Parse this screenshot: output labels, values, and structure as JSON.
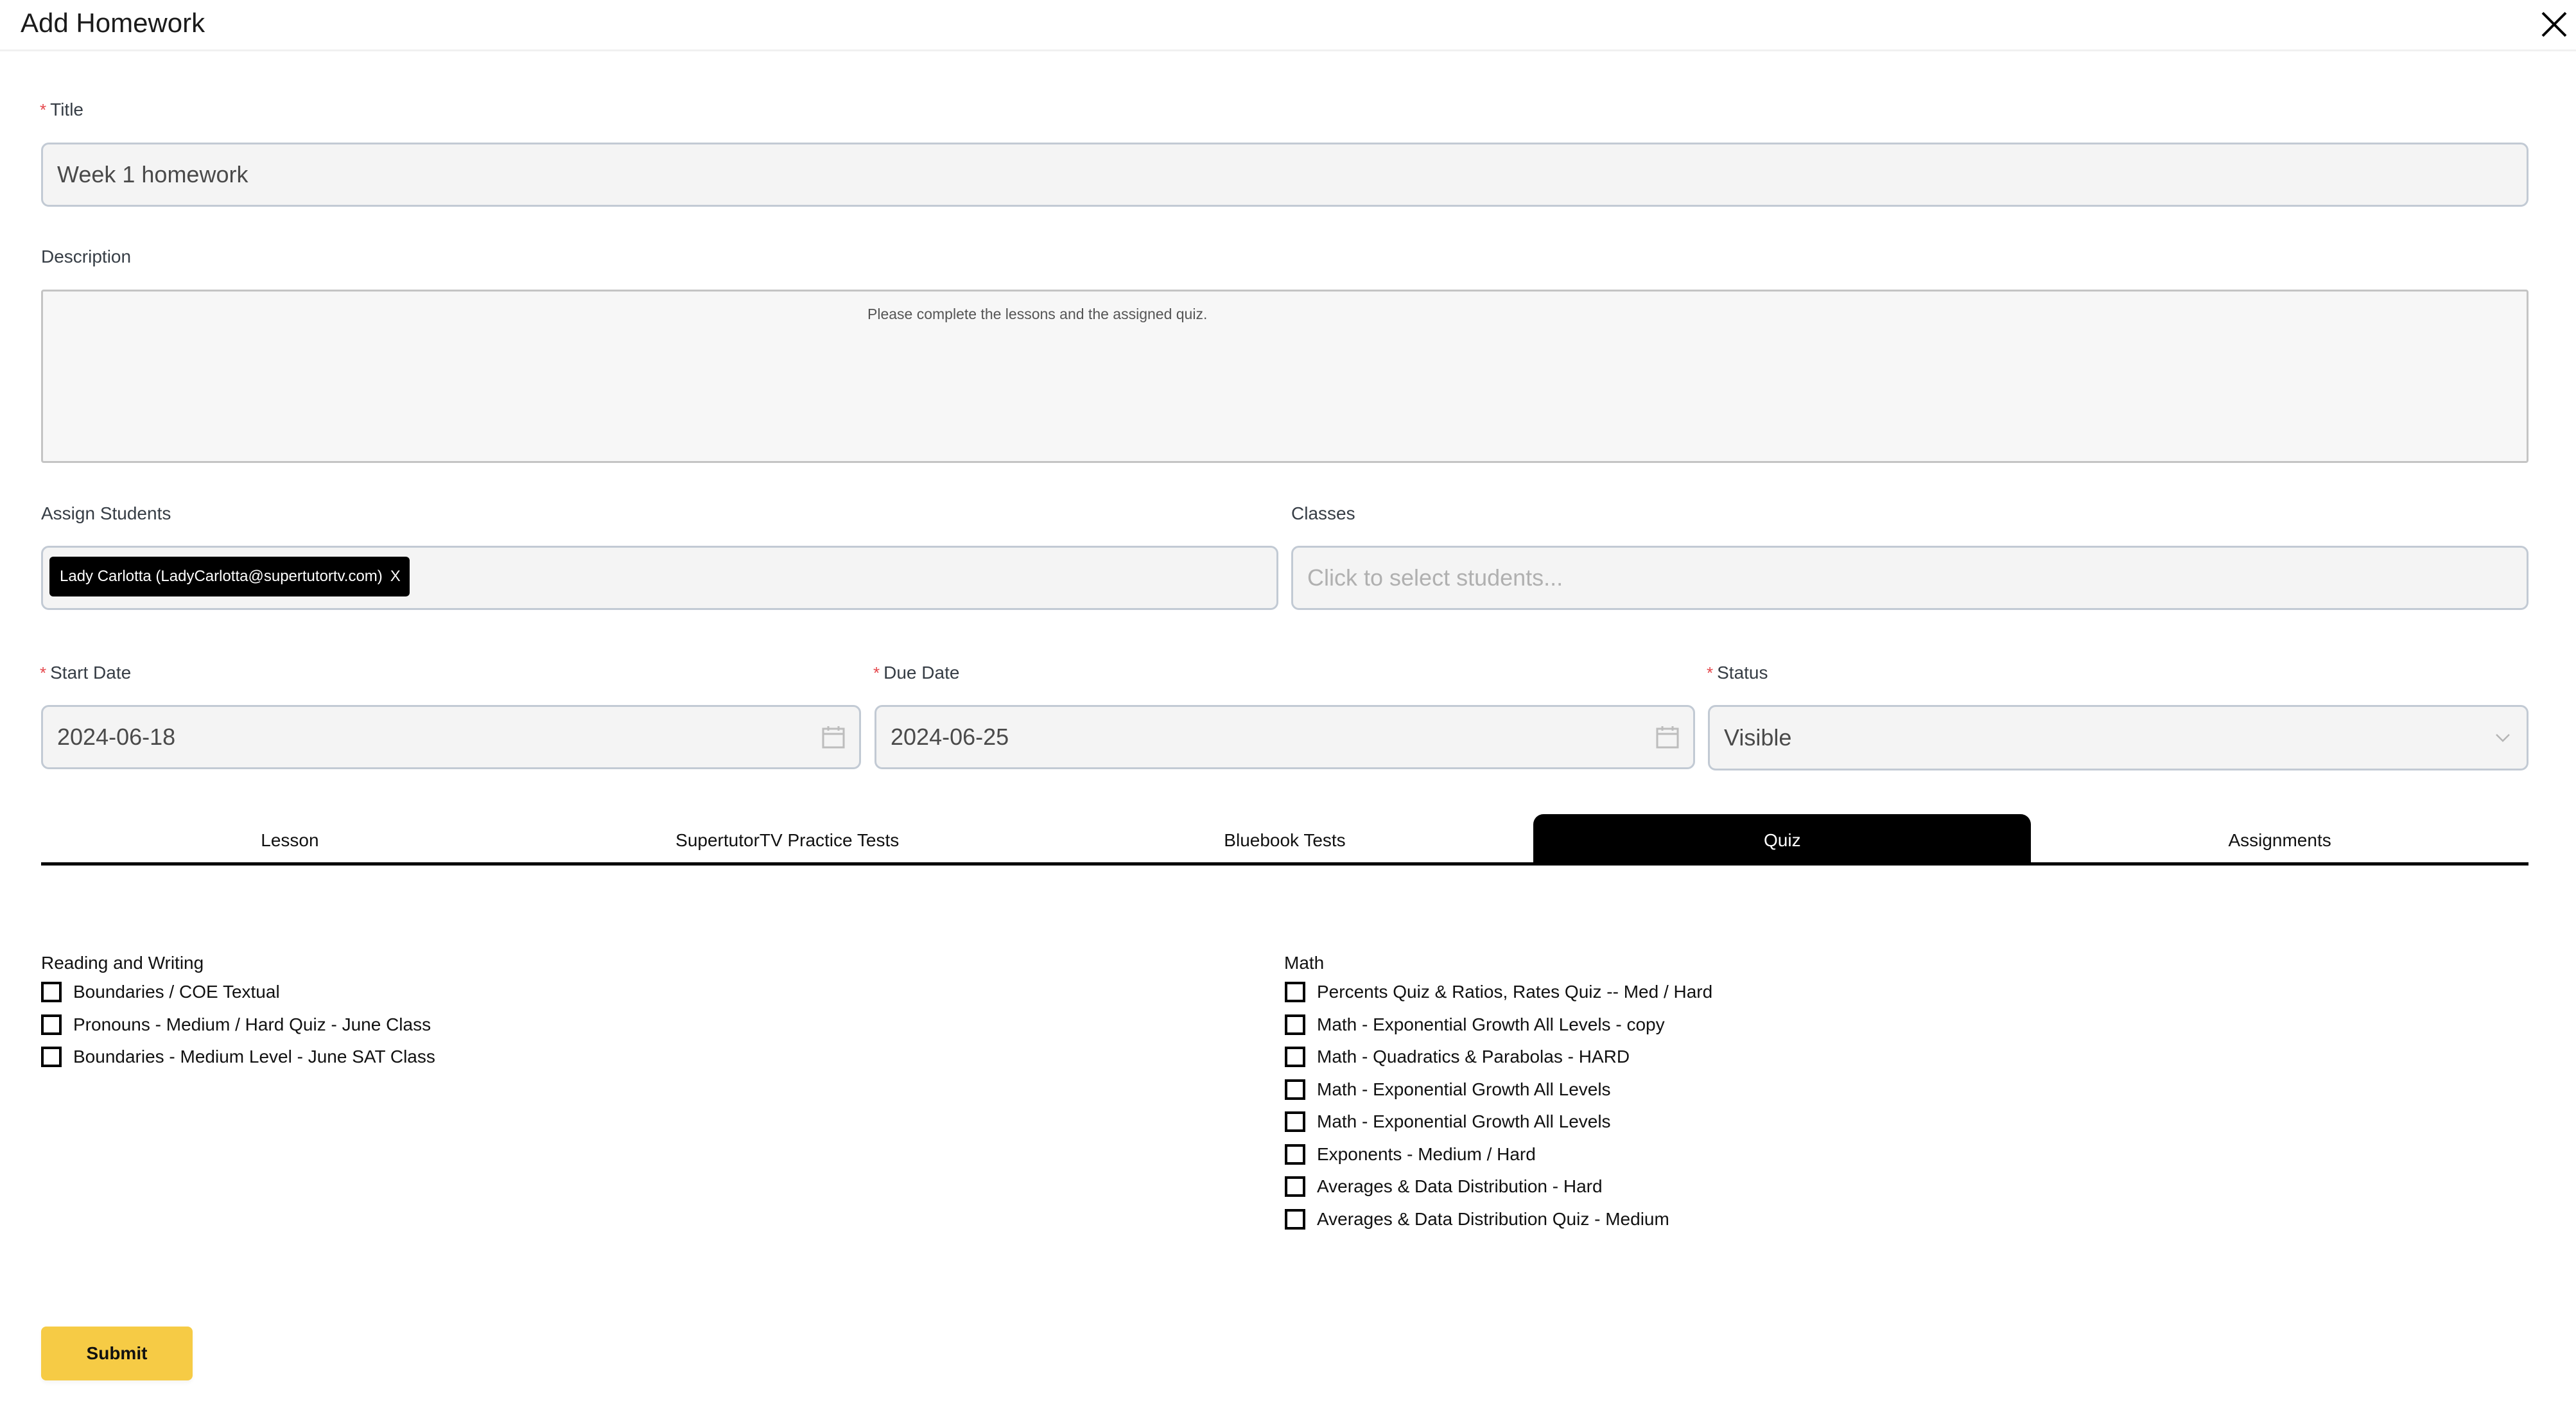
{
  "header": {
    "title": "Add Homework",
    "close_icon": "close-icon"
  },
  "form": {
    "title": {
      "label": "Title",
      "required": true,
      "value": "Week 1 homework"
    },
    "description": {
      "label": "Description",
      "value": "Please complete the lessons and the assigned quiz."
    },
    "assign_students": {
      "label": "Assign Students",
      "selected": [
        {
          "label": "Lady Carlotta (LadyCarlotta@supertutortv.com)",
          "remove_label": "X"
        }
      ]
    },
    "classes": {
      "label": "Classes",
      "placeholder": "Click to select students..."
    },
    "start_date": {
      "label": "Start Date",
      "required": true,
      "value": "2024-06-18",
      "icon": "calendar-icon"
    },
    "due_date": {
      "label": "Due Date",
      "required": true,
      "value": "2024-06-25",
      "icon": "calendar-icon"
    },
    "status": {
      "label": "Status",
      "required": true,
      "value": "Visible",
      "icon": "chevron-down-icon"
    }
  },
  "tabs": [
    {
      "label": "Lesson",
      "active": false
    },
    {
      "label": "SupertutorTV Practice Tests",
      "active": false
    },
    {
      "label": "Bluebook Tests",
      "active": false
    },
    {
      "label": "Quiz",
      "active": true
    },
    {
      "label": "Assignments",
      "active": false
    }
  ],
  "quiz": {
    "reading_writing": {
      "title": "Reading and Writing",
      "items": [
        {
          "label": "Boundaries / COE Textual",
          "checked": false
        },
        {
          "label": "Pronouns - Medium / Hard Quiz - June Class",
          "checked": false
        },
        {
          "label": "Boundaries - Medium Level - June SAT Class",
          "checked": false
        }
      ]
    },
    "math": {
      "title": "Math",
      "items": [
        {
          "label": "Percents Quiz & Ratios, Rates Quiz -- Med / Hard",
          "checked": false
        },
        {
          "label": "Math - Exponential Growth All Levels - copy",
          "checked": false
        },
        {
          "label": "Math - Quadratics & Parabolas - HARD",
          "checked": false
        },
        {
          "label": "Math - Exponential Growth All Levels",
          "checked": false
        },
        {
          "label": "Math - Exponential Growth All Levels",
          "checked": false
        },
        {
          "label": "Exponents - Medium / Hard",
          "checked": false
        },
        {
          "label": "Averages & Data Distribution - Hard",
          "checked": false
        },
        {
          "label": "Averages & Data Distribution Quiz - Medium",
          "checked": false
        }
      ]
    }
  },
  "actions": {
    "submit_label": "Submit"
  },
  "colors": {
    "required_marker": "#e5484d",
    "submit_bg": "#f6cb45",
    "active_tab_bg": "#000000",
    "chip_bg": "#000000",
    "field_bg": "#f4f4f4",
    "field_border": "#c2cad4"
  }
}
